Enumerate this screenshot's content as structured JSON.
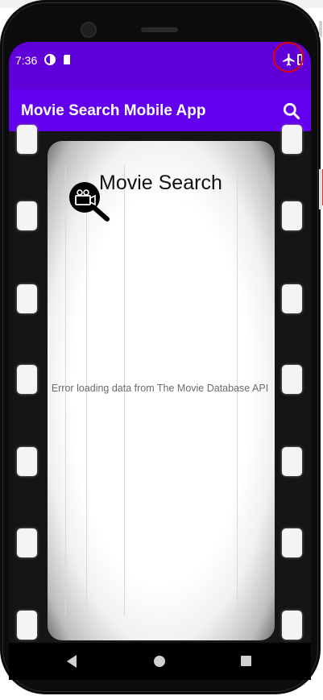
{
  "status_bar": {
    "time": "7:36",
    "background": "#5f00d9",
    "icons": [
      "data-saver-icon",
      "sd-card-icon",
      "airplane-mode-icon",
      "battery-icon"
    ],
    "annotation_color": "#e00000"
  },
  "app_bar": {
    "title": "Movie Search Mobile App",
    "background": "#6200ee",
    "action_icon": "search-icon"
  },
  "main": {
    "headline": "Movie Search",
    "logo_icon": "movie-camera-search-icon",
    "error_message": "Error loading data from The Movie Database API",
    "background_theme": "film-strip"
  },
  "nav_bar": {
    "buttons": [
      "back-icon",
      "home-icon",
      "recents-icon"
    ]
  }
}
